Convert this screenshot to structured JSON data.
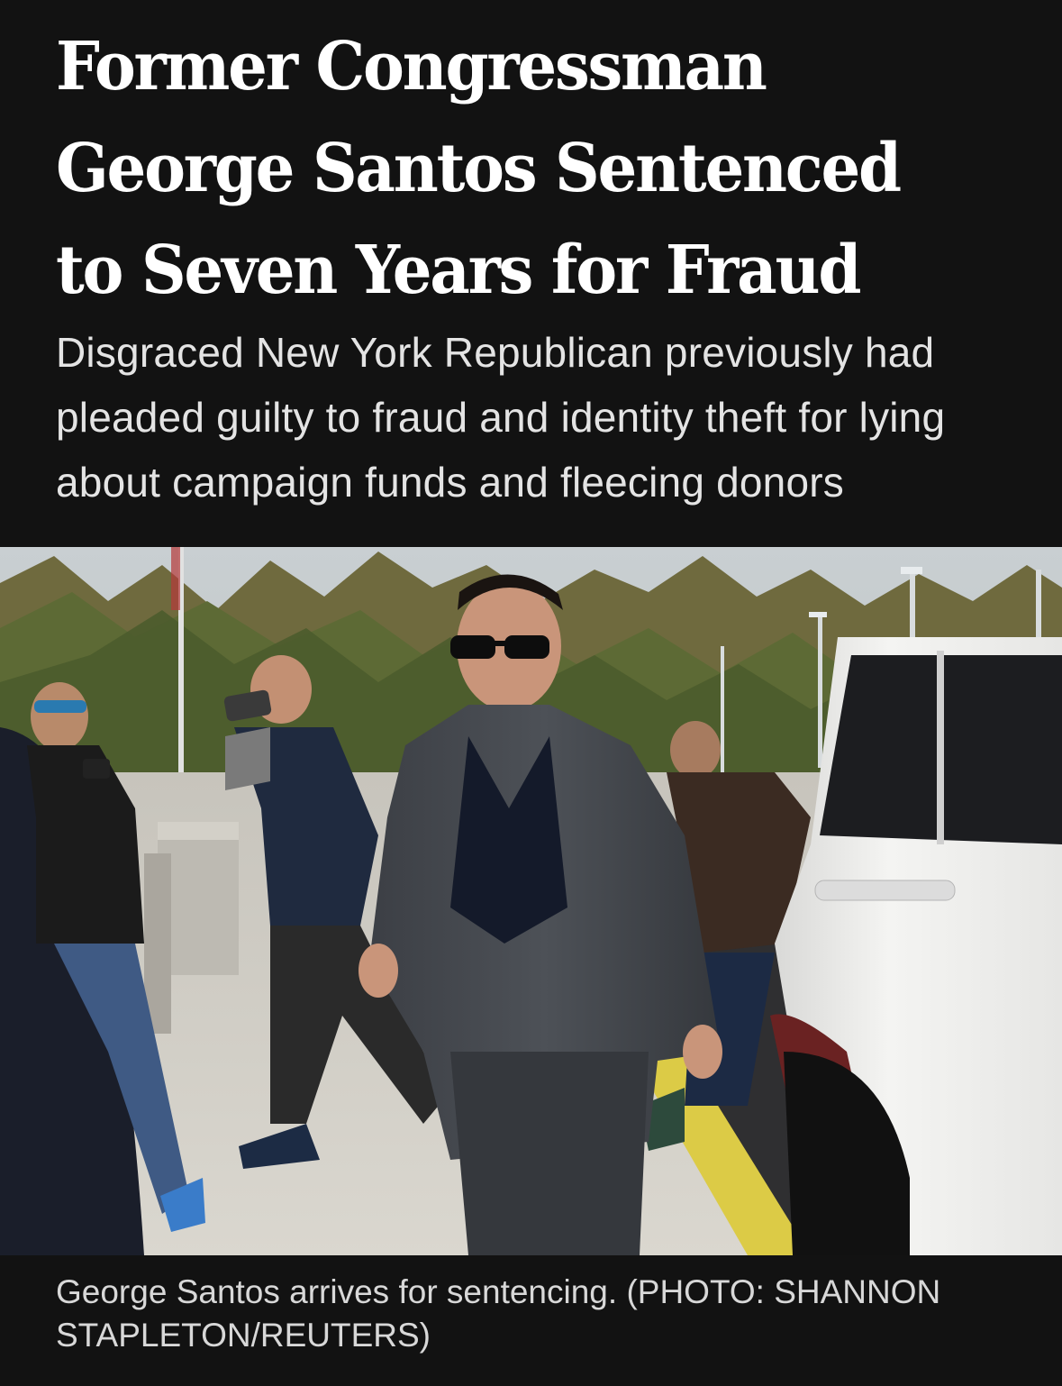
{
  "article": {
    "headline": "Former Congressman George Santos Sentenced to Seven Years for Fraud",
    "dek": "Disgraced New York Republican previously had pleaded guilty to fraud and identity theft for lying about campaign funds and fleecing donors",
    "photo": {
      "caption": "George Santos arrives for sentencing. (PHOTO: SHANNON STAPLETON/REUTERS)"
    }
  },
  "colors": {
    "background": "#121212",
    "headline_text": "#ffffff",
    "dek_text": "#e4e4e4",
    "caption_text": "#d8d8d8"
  }
}
